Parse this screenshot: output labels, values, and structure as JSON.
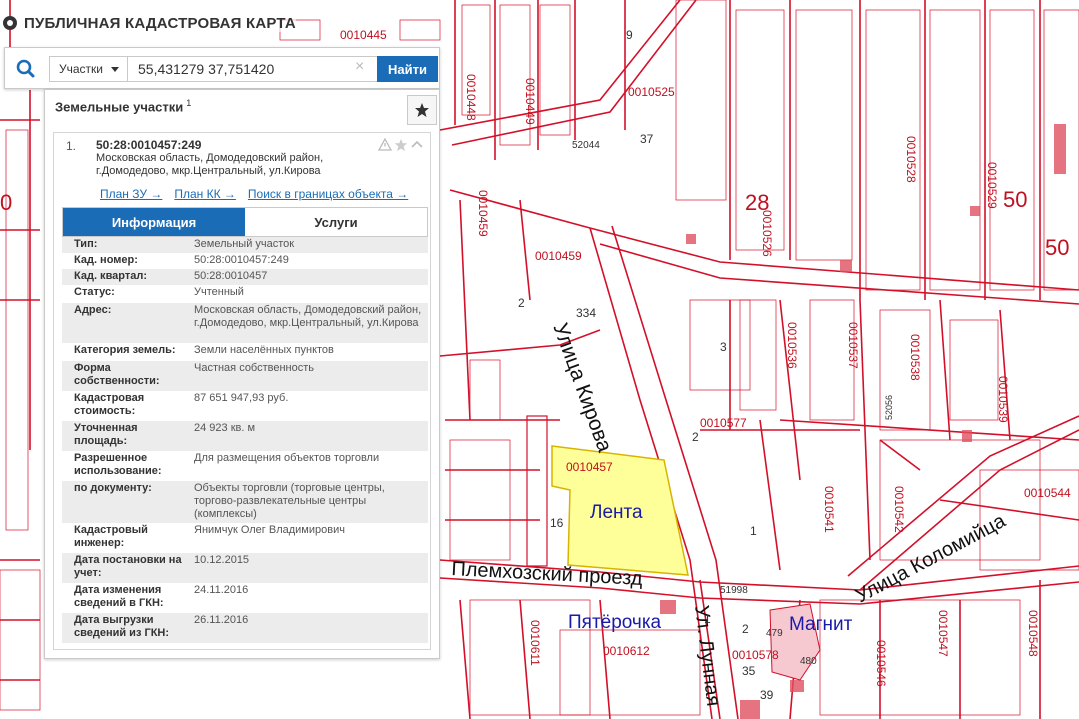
{
  "app": {
    "title": "ПУБЛИЧНАЯ КАДАСТРОВАЯ КАРТА"
  },
  "search": {
    "type_label": "Участки",
    "query": "55,431279 37,751420",
    "submit_label": "Найти"
  },
  "results": {
    "title": "Земельные участки",
    "count": "1"
  },
  "card": {
    "index": "1.",
    "cad_number": "50:28:0010457:249",
    "address": "Московская область, Домодедовский район, г.Домодедово, мкр.Центральный, ул.Кирова",
    "links": [
      "План ЗУ →",
      "План КК →",
      "Поиск в границах объекта →"
    ],
    "tabs": {
      "info": "Информация",
      "services": "Услуги"
    },
    "rows": [
      {
        "k": "Тип:",
        "v": "Земельный участок"
      },
      {
        "k": "Кад. номер:",
        "v": "50:28:0010457:249"
      },
      {
        "k": "Кад. квартал:",
        "v": "50:28:0010457"
      },
      {
        "k": "Статус:",
        "v": "Учтенный"
      },
      {
        "k": "Адрес:",
        "v": "Московская область, Домодедовский район, г.Домодедово, мкр.Центральный, ул.Кирова"
      },
      {
        "k": "Категория земель:",
        "v": "Земли населённых пунктов"
      },
      {
        "k": "Форма собственности:",
        "v": "Частная собственность"
      },
      {
        "k": "Кадастровая стоимость:",
        "v": "87 651 947,93 руб."
      },
      {
        "k": "Уточненная площадь:",
        "v": "24 923 кв. м"
      },
      {
        "k": "Разрешенное использование:",
        "v": "Для размещения объектов торговли"
      },
      {
        "k": "по документу:",
        "v": "Объекты торговли (торговые центры, торгово-развлекательные центры (комплексы)"
      },
      {
        "k": "Кадастровый инженер:",
        "v": "Янимчук Олег Владимирович"
      },
      {
        "k": "Дата постановки на учет:",
        "v": "10.12.2015"
      },
      {
        "k": "Дата изменения сведений в ГКН:",
        "v": "24.11.2016"
      },
      {
        "k": "Дата выгрузки сведений из ГКН:",
        "v": "26.11.2016"
      }
    ]
  },
  "map": {
    "streets": {
      "kirova": "Улица Кирова",
      "plemkhoz": "Племхозский проезд",
      "lunnaya": "Ул. Лунная",
      "kolomiytsa": "Улица Коломийца"
    },
    "stores": {
      "lenta": "Лента",
      "pyaterochka": "Пятёрочка",
      "magnit": "Магнит"
    },
    "blocks": {
      "b0010445": "0010445",
      "b0010449": "0010449",
      "b0010448": "0010448",
      "b0010525": "0010525",
      "b0010459a": "0010459",
      "b0010459b": "0010459",
      "b0010457": "0010457",
      "b0010577": "0010577",
      "b0010526": "0010526",
      "b0010528": "0010528",
      "b0010529": "0010529",
      "b0010536": "0010536",
      "b0010537": "0010537",
      "b0010538": "0010538",
      "b0010539": "0010539",
      "b0010541": "0010541",
      "b0010542": "0010542",
      "b0010544": "0010544",
      "b0010578": "0010578",
      "b0010612": "0010612",
      "b0010611": "0010611",
      "b0010547": "0010547",
      "b0010548": "0010548",
      "b0010546": "0010546"
    },
    "big": {
      "n50a": "50",
      "n50b": "50",
      "n28": "28",
      "n0": "0"
    },
    "nums": {
      "p334": "334",
      "p52044": "52044",
      "p51998": "51998",
      "p52056": "52056",
      "p3": "3",
      "p2a": "2",
      "p2b": "2",
      "p1a": "1",
      "p1b": "1",
      "p2c": "2",
      "p16": "16",
      "p9": "9",
      "p37": "37",
      "p479": "479",
      "p480": "480",
      "p35": "35",
      "p39": "39"
    }
  },
  "colors": {
    "accent": "#1b6cb7",
    "parcel_line": "#d3102a",
    "highlight": "#ffff99"
  }
}
